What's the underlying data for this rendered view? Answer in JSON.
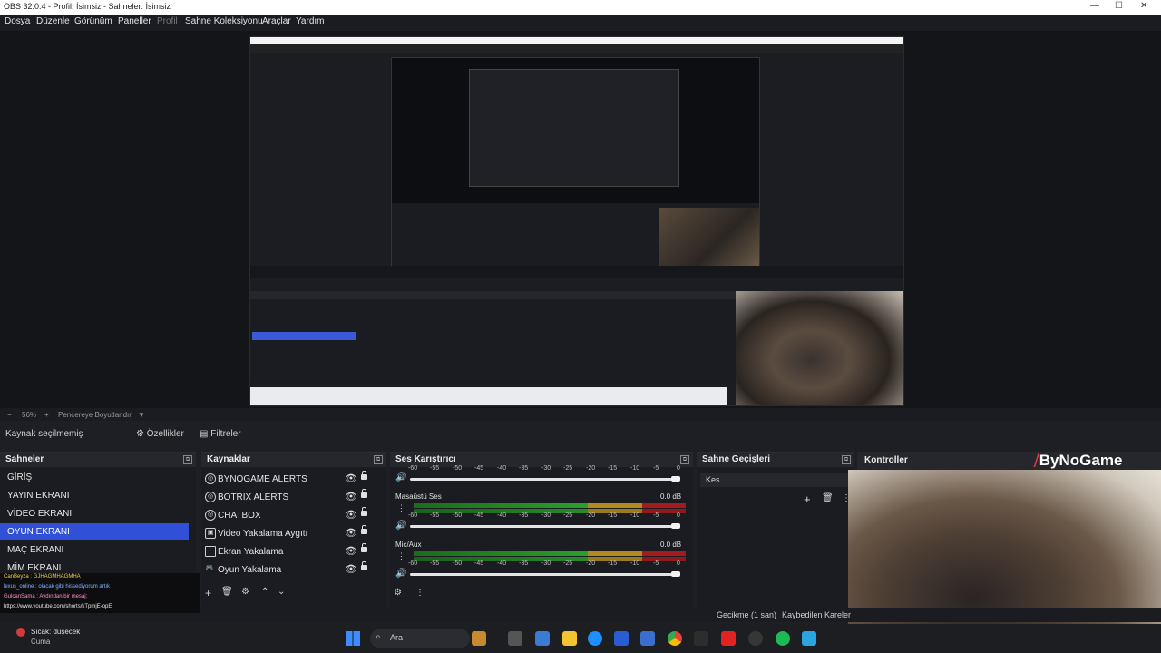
{
  "window": {
    "title": "OBS 32.0.4 - Profil: İsimsiz - Sahneler: İsimsiz"
  },
  "menu": [
    "Dosya",
    "Düzenle",
    "Görünüm",
    "Paneller",
    "Profil",
    "Sahne Koleksiyonu",
    "Araçlar",
    "Yardım"
  ],
  "zoom": {
    "percent": "56%",
    "fit_label": "Pencereye Boyutlandır"
  },
  "source_bar": {
    "selected": "Kaynak seçilmemiş",
    "properties": "Özellikler",
    "filters": "Filtreler"
  },
  "scenes": {
    "title": "Sahneler",
    "items": [
      "GİRİŞ",
      "YAYIN EKRANI",
      "VİDEO EKRANI",
      "OYUN EKRANI",
      "MAÇ EKRANI",
      "MİM EKRANI"
    ],
    "selected_index": 3
  },
  "sources": {
    "title": "Kaynaklar",
    "items": [
      "BYNOGAME ALERTS",
      "BOTRİX ALERTS",
      "CHATBOX",
      "Video Yakalama Aygıtı",
      "Ekran Yakalama",
      "Oyun Yakalama"
    ]
  },
  "mixer": {
    "title": "Ses Karıştırıcı",
    "scale": [
      "-60",
      "-55",
      "-50",
      "-45",
      "-40",
      "-35",
      "-30",
      "-25",
      "-20",
      "-15",
      "-10",
      "-5",
      "0"
    ],
    "channels": [
      {
        "name": "Masaüstü Ses",
        "db": "0.0 dB"
      },
      {
        "name": "Mic/Aux",
        "db": "0.0 dB"
      }
    ]
  },
  "transitions": {
    "title": "Sahne Geçişleri",
    "current": "Kes"
  },
  "controls": {
    "title": "Kontroller"
  },
  "brand": "ByNoGame",
  "status": {
    "delay": "Gecikme (1 san)",
    "dropped": "Kaybedilen Kareler"
  },
  "chat": {
    "lines": [
      "CanBeyza : GJHAGMHAGMHA",
      "lexus_online : olacak gibi hissediyorum artık",
      "GulcanSama : Aydından bir mesaj:",
      "https://www.youtube.com/shorts/kTpmjE-opE"
    ]
  },
  "taskbar": {
    "weather_top": "Sıcak: düşecek",
    "weather_bottom": "Cuma",
    "search": "Ara"
  }
}
